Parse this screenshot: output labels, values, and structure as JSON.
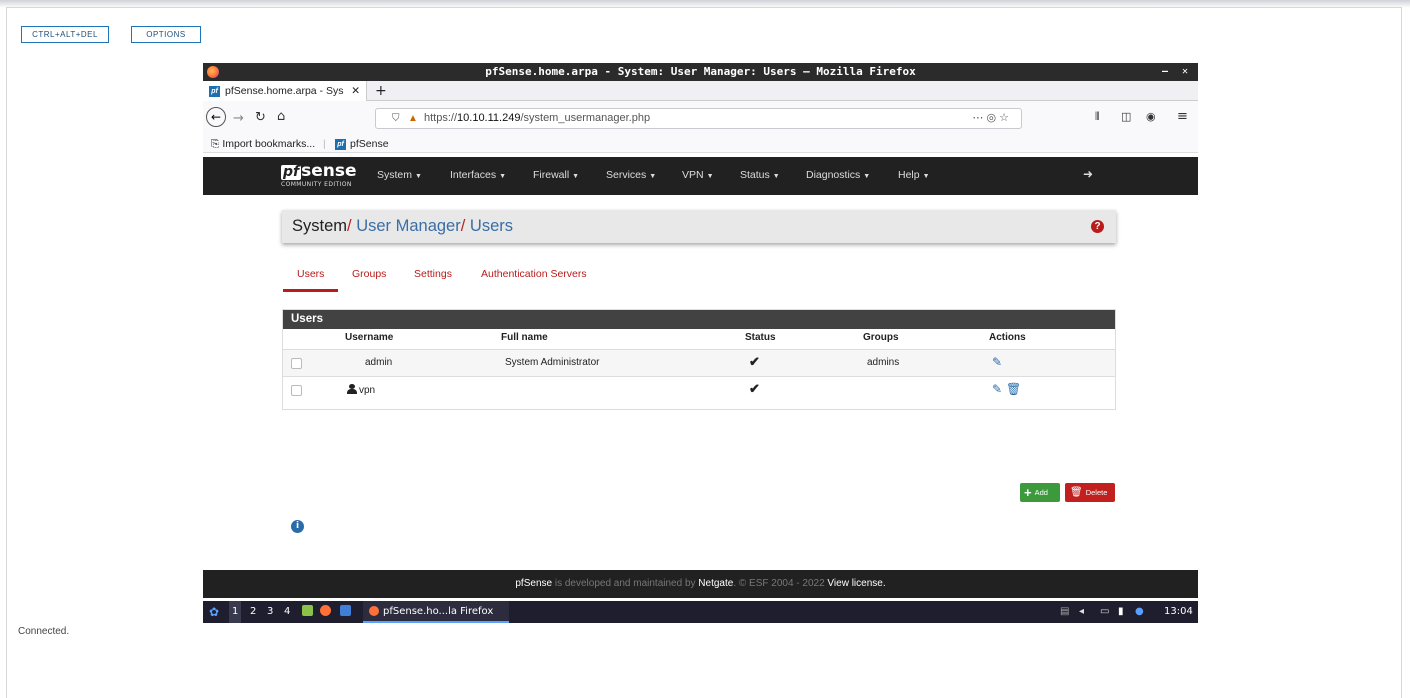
{
  "console": {
    "ctrl_alt_del": "CTRL+ALT+DEL",
    "options": "OPTIONS",
    "status": "Connected."
  },
  "window": {
    "title": "pfSense.home.arpa - System: User Manager: Users — Mozilla Firefox",
    "controls": "– ✕"
  },
  "browser": {
    "tab_title": "pfSense.home.arpa - Sys",
    "url_prefix": "https://",
    "url_host": "10.10.11.249",
    "url_path": "/system_usermanager.php",
    "bookmarks": {
      "import": "Import bookmarks...",
      "pfsense": "pfSense"
    }
  },
  "pfsense": {
    "logo_pf": "pf",
    "logo_sense": "sense",
    "logo_sub": "COMMUNITY EDITION",
    "menu": [
      "System",
      "Interfaces",
      "Firewall",
      "Services",
      "VPN",
      "Status",
      "Diagnostics",
      "Help"
    ]
  },
  "breadcrumb": {
    "system": "System",
    "user_manager": "User Manager",
    "users": "Users"
  },
  "subtabs": [
    "Users",
    "Groups",
    "Settings",
    "Authentication Servers"
  ],
  "users_panel": {
    "heading": "Users",
    "columns": [
      "Username",
      "Full name",
      "Status",
      "Groups",
      "Actions"
    ],
    "rows": [
      {
        "username": "admin",
        "full_name": "System Administrator",
        "status": "✔",
        "groups": "admins"
      },
      {
        "username": "vpn",
        "full_name": "",
        "status": "✔",
        "groups": ""
      }
    ]
  },
  "buttons": {
    "add": "Add",
    "delete": "Delete"
  },
  "footer": {
    "brand": "pfSense",
    "text1": " is developed and maintained by ",
    "netgate": "Netgate",
    "text2": ". © ESF 2004 - 2022 ",
    "license": "View license."
  },
  "taskbar": {
    "workspaces": [
      "1",
      "2",
      "3",
      "4"
    ],
    "window": "pfSense.ho...la Firefox",
    "clock": "13:04"
  }
}
